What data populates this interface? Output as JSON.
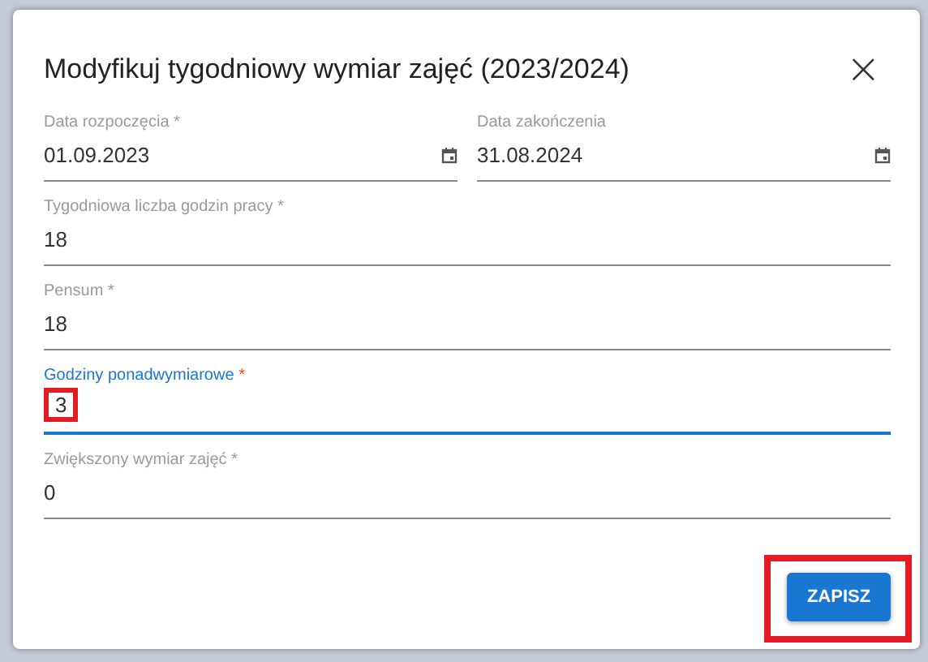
{
  "dialog": {
    "title": "Modyfikuj tygodniowy wymiar zajęć (2023/2024)",
    "close_label": "×"
  },
  "fields": [
    {
      "kind": "date",
      "label": "Data rozpoczęcia",
      "required_mark": "*",
      "value": "01.09.2023",
      "focused": false,
      "highlighted": false
    },
    {
      "kind": "date",
      "label": "Data zakończenia",
      "value": "31.08.2024",
      "focused": false,
      "highlighted": false
    },
    {
      "kind": "text",
      "label": "Tygodniowa liczba godzin pracy",
      "required_mark": "*",
      "value": "18",
      "focused": false,
      "highlighted": false
    },
    {
      "kind": "text",
      "label": "Pensum",
      "required_mark": "*",
      "value": "18",
      "focused": false,
      "highlighted": false
    },
    {
      "kind": "text",
      "label": "Godziny ponadwymiarowe",
      "required_mark": "*",
      "value": "3",
      "focused": true,
      "highlighted": true
    },
    {
      "kind": "text",
      "label": "Zwiększony wymiar zajęć",
      "required_mark": "*",
      "value": "0",
      "focused": false,
      "highlighted": false
    }
  ],
  "save_button": {
    "label": "ZAPISZ",
    "highlighted": true
  }
}
